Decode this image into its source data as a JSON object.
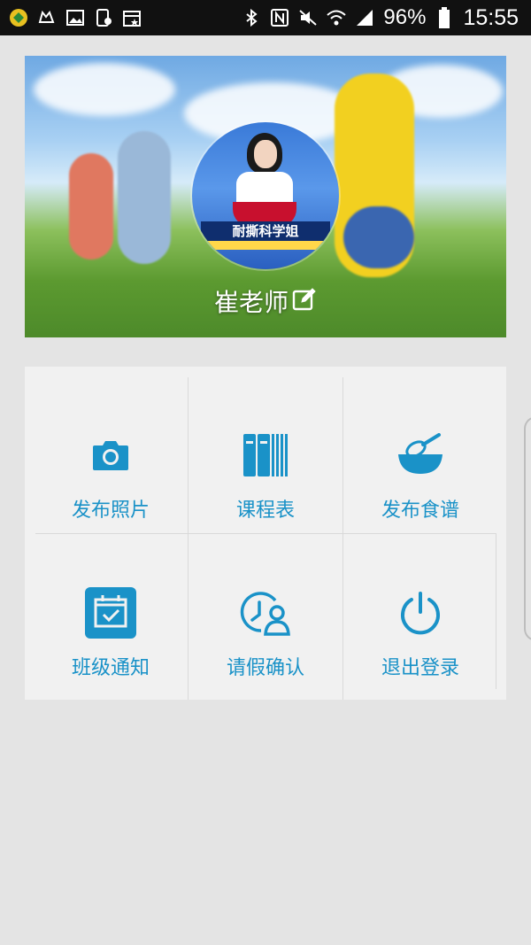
{
  "status_bar": {
    "icons_left": [
      "app-icon",
      "cat-icon",
      "image-icon",
      "phone-lock-icon",
      "calendar-star-icon"
    ],
    "icons_right": [
      "bluetooth-icon",
      "nfc-icon",
      "mute-icon",
      "wifi-icon",
      "signal-icon"
    ],
    "battery": "96%",
    "time": "15:55"
  },
  "profile": {
    "avatar_banner": "耐撕科学姐",
    "name": "崔老师"
  },
  "menu": {
    "items": [
      {
        "label": "发布照片",
        "icon": "camera-icon"
      },
      {
        "label": "课程表",
        "icon": "books-icon"
      },
      {
        "label": "发布食谱",
        "icon": "mixing-bowl-icon"
      },
      {
        "label": "班级通知",
        "icon": "calendar-check-icon"
      },
      {
        "label": "请假确认",
        "icon": "clock-person-icon"
      },
      {
        "label": "退出登录",
        "icon": "power-icon"
      }
    ]
  },
  "colors": {
    "accent": "#1a92c8",
    "background": "#e4e4e4",
    "grid": "#f1f1f1"
  }
}
